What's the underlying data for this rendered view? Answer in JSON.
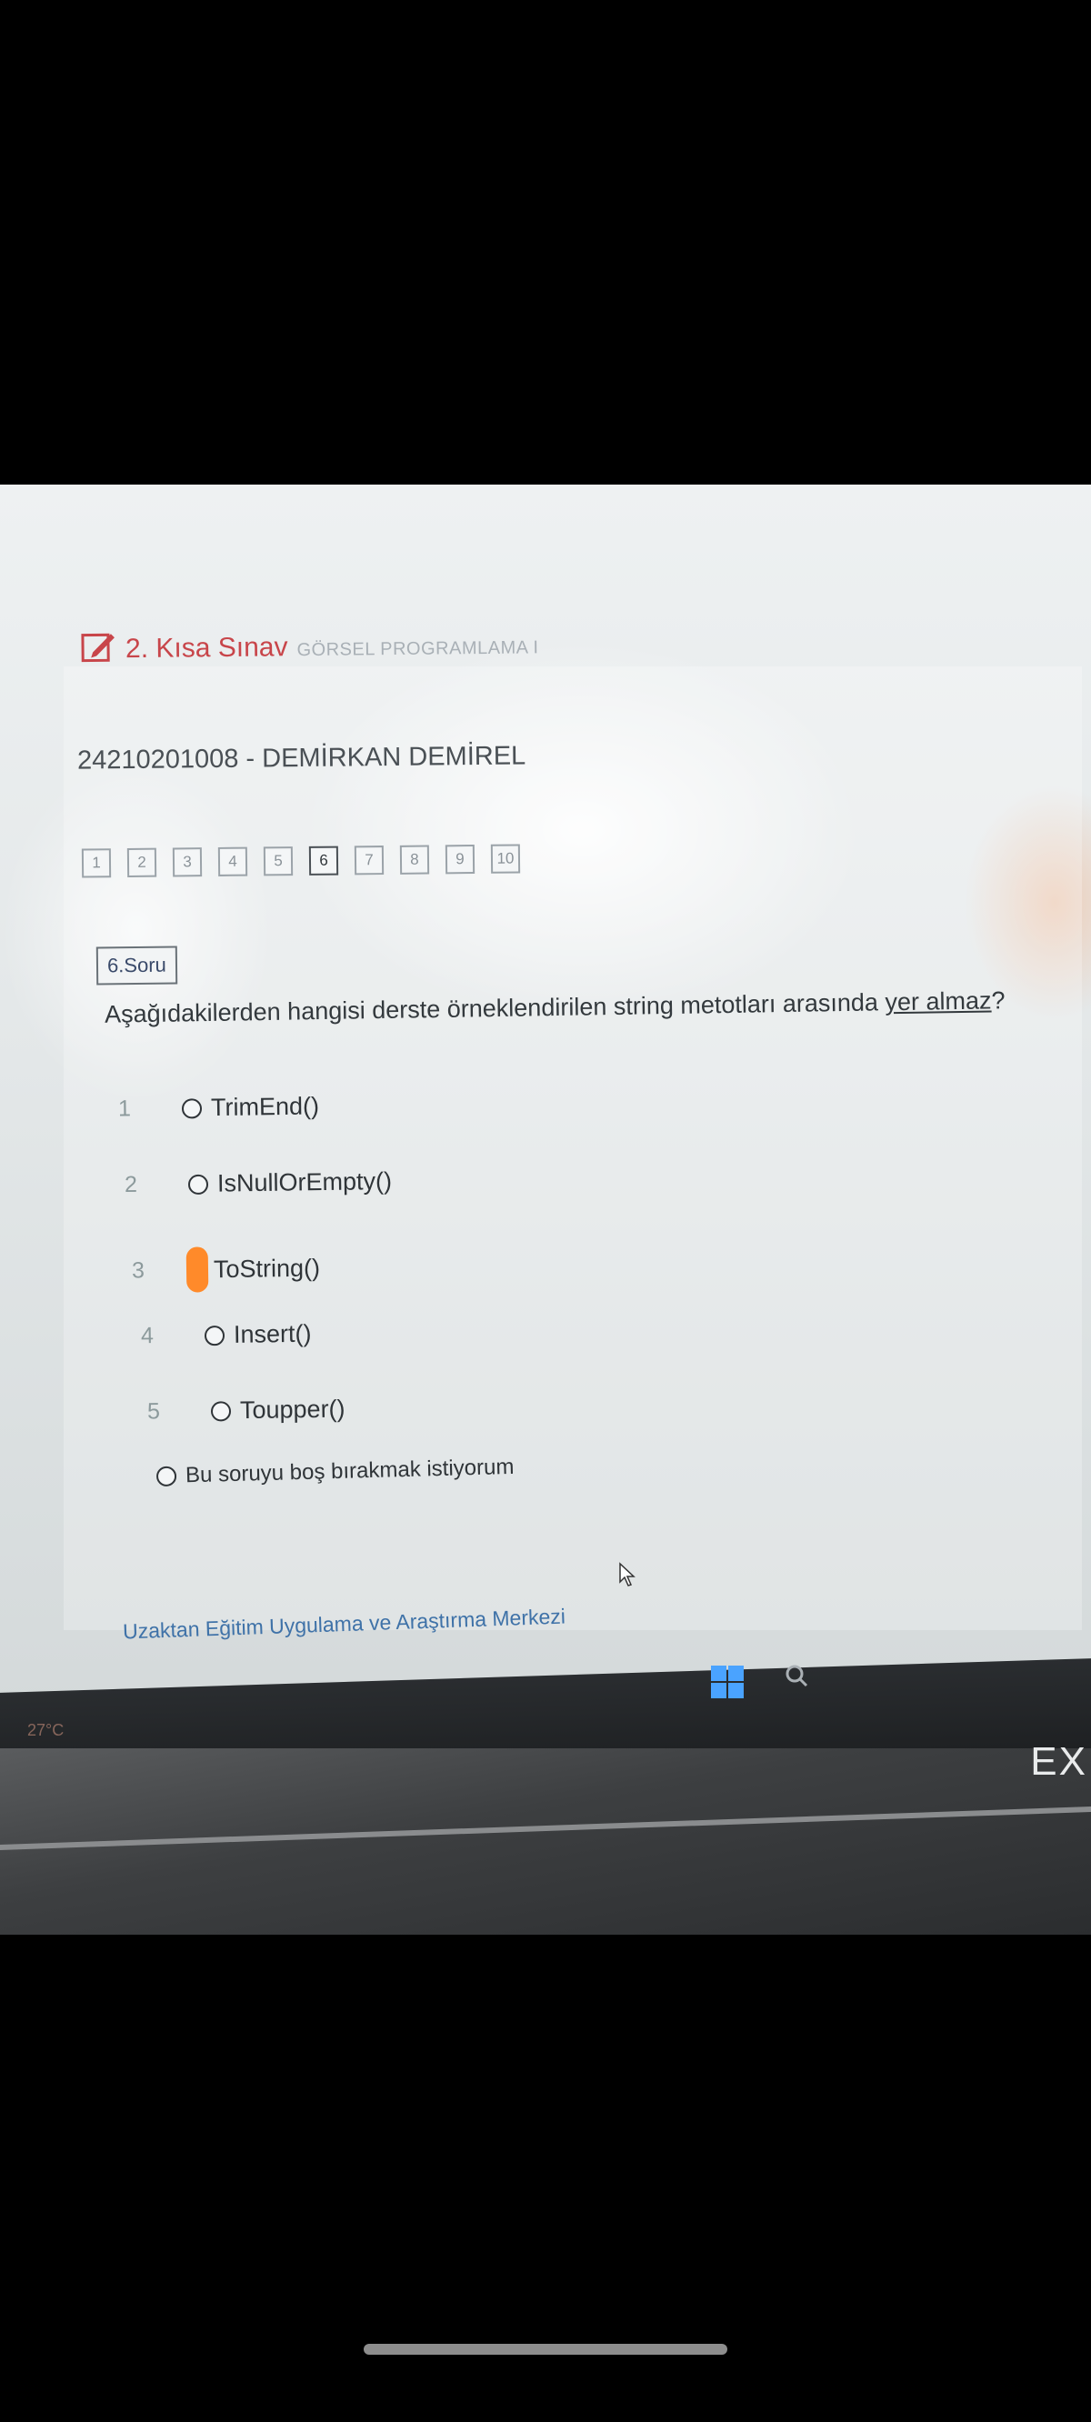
{
  "exam": {
    "title": "2. Kısa Sınav",
    "course": "GÖRSEL PROGRAMLAMA I",
    "student": "24210201008 - DEMİRKAN DEMİREL"
  },
  "question_nav": [
    "1",
    "2",
    "3",
    "4",
    "5",
    "6",
    "7",
    "8",
    "9",
    "10"
  ],
  "active_question": "6",
  "question": {
    "badge": "6.Soru",
    "text_before": "Aşağıdakilerden hangisi derste örneklendirilen string metotları arasında ",
    "text_underlined": "yer almaz",
    "text_after": "?",
    "options": [
      {
        "num": "1",
        "label": "TrimEnd()"
      },
      {
        "num": "2",
        "label": "IsNullOrEmpty()"
      },
      {
        "num": "3",
        "label": "ToString()"
      },
      {
        "num": "4",
        "label": "Insert()"
      },
      {
        "num": "5",
        "label": "Toupper()"
      }
    ],
    "skip_label": "Bu soruyu boş bırakmak istiyorum"
  },
  "footer": {
    "link": "Uzaktan Eğitim Uygulama ve Araştırma Merkezi"
  },
  "taskbar": {
    "weather_temp": "27°C"
  },
  "laptop": {
    "brand": "EX"
  },
  "colors": {
    "title": "#c8454a",
    "link": "#3f72a8",
    "marker": "#ff8a2a"
  }
}
